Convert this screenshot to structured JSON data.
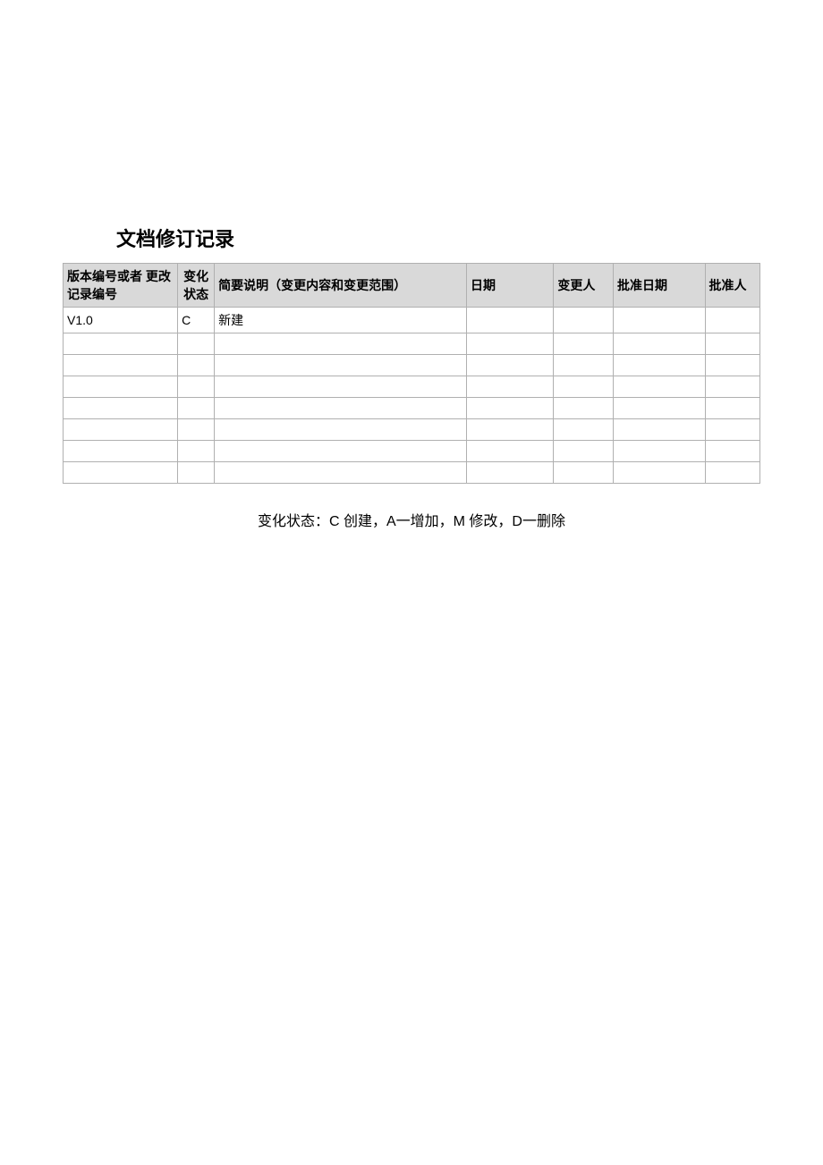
{
  "title": "文档修订记录",
  "headers": {
    "version": "版本编号或者 更改记录编号",
    "state": "变化 状态",
    "desc": "简要说明（变更内容和变更范围）",
    "date": "日期",
    "changer": "变更人",
    "appdate": "批准日期",
    "approver": "批准人"
  },
  "rows": [
    {
      "version": "V1.0",
      "state": "C",
      "desc": "新建",
      "date": "",
      "changer": "",
      "appdate": "",
      "approver": ""
    },
    {
      "version": "",
      "state": "",
      "desc": "",
      "date": "",
      "changer": "",
      "appdate": "",
      "approver": ""
    },
    {
      "version": "",
      "state": "",
      "desc": "",
      "date": "",
      "changer": "",
      "appdate": "",
      "approver": ""
    },
    {
      "version": "",
      "state": "",
      "desc": "",
      "date": "",
      "changer": "",
      "appdate": "",
      "approver": ""
    },
    {
      "version": "",
      "state": "",
      "desc": "",
      "date": "",
      "changer": "",
      "appdate": "",
      "approver": ""
    },
    {
      "version": "",
      "state": "",
      "desc": "",
      "date": "",
      "changer": "",
      "appdate": "",
      "approver": ""
    },
    {
      "version": "",
      "state": "",
      "desc": "",
      "date": "",
      "changer": "",
      "appdate": "",
      "approver": ""
    },
    {
      "version": "",
      "state": "",
      "desc": "",
      "date": "",
      "changer": "",
      "appdate": "",
      "approver": ""
    }
  ],
  "legend": "变化状态：C 创建，A一增加，M 修改，D一删除"
}
